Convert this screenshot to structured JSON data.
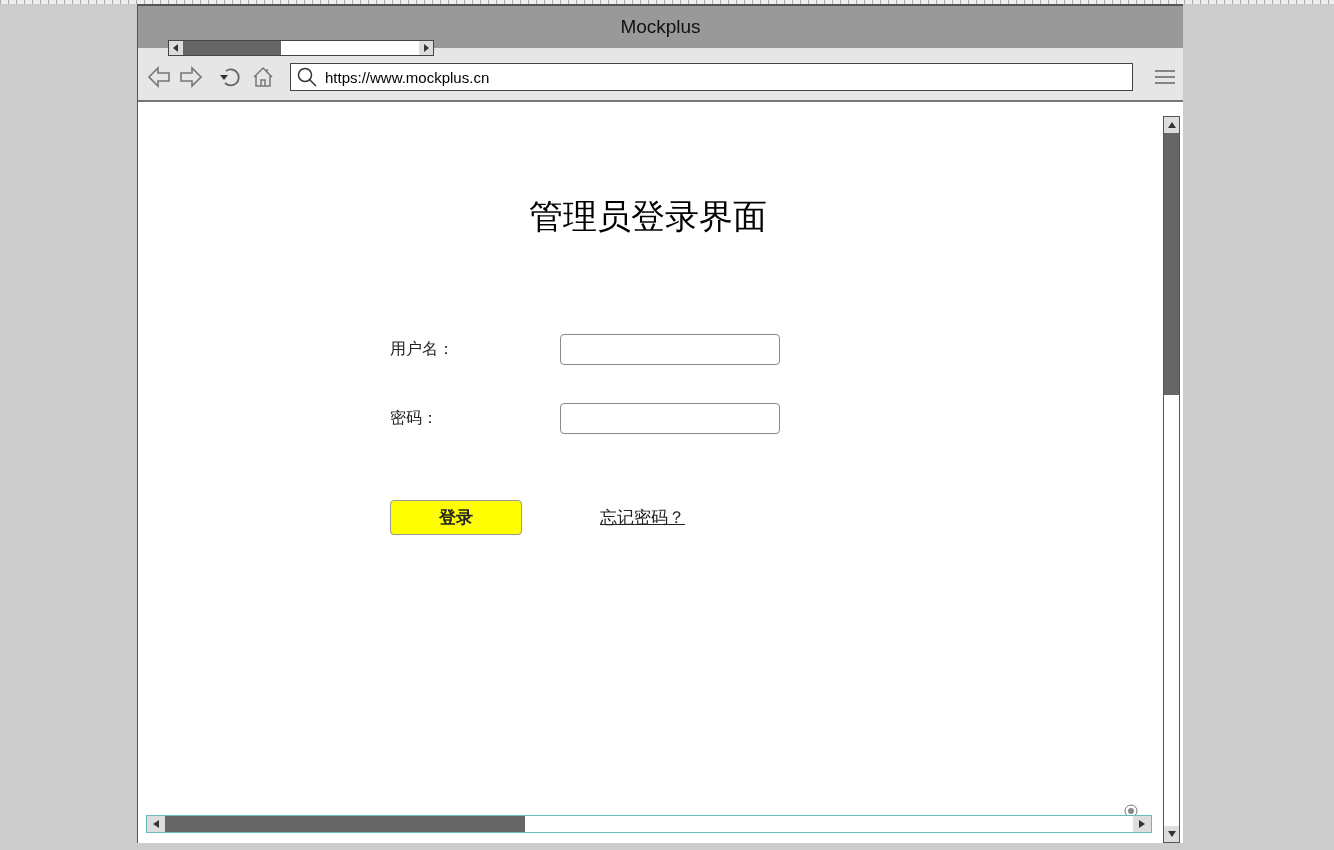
{
  "window": {
    "title": "Mockplus"
  },
  "address_bar": {
    "url": "https://www.mockplus.cn"
  },
  "page": {
    "heading": "管理员登录界面",
    "fields": [
      {
        "label": "用户名："
      },
      {
        "label": "密码："
      }
    ],
    "login_button": "登录",
    "forgot_link": "忘记密码？"
  }
}
